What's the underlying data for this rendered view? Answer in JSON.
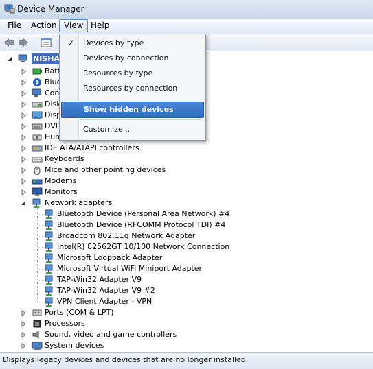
{
  "window": {
    "title": "Device Manager"
  },
  "menubar": {
    "file": "File",
    "action": "Action",
    "view": "View",
    "help": "Help"
  },
  "view_menu": {
    "items": [
      {
        "label": "Devices by type",
        "checked": true
      },
      {
        "label": "Devices by connection",
        "checked": false
      },
      {
        "label": "Resources by type",
        "checked": false
      },
      {
        "label": "Resources by connection",
        "checked": false
      },
      {
        "label": "Show hidden devices",
        "highlighted": true
      },
      {
        "label": "Customize..."
      }
    ],
    "check_glyph": "✓"
  },
  "tree": {
    "root": "NISHA",
    "categories": [
      {
        "label": "Batt",
        "icon": "battery-icon",
        "expanded": false
      },
      {
        "label": "Blue",
        "icon": "bluetooth-icon",
        "expanded": false
      },
      {
        "label": "Con",
        "icon": "computer-icon",
        "expanded": false
      },
      {
        "label": "Disk",
        "icon": "disk-drive-icon",
        "expanded": false
      },
      {
        "label": "Disp",
        "icon": "display-adapter-icon",
        "expanded": false
      },
      {
        "label": "DVD",
        "icon": "dvd-drive-icon",
        "expanded": false
      },
      {
        "label": "Human Interface Devices",
        "icon": "hid-icon",
        "expanded": false
      },
      {
        "label": "IDE ATA/ATAPI controllers",
        "icon": "ide-controller-icon",
        "expanded": false
      },
      {
        "label": "Keyboards",
        "icon": "keyboard-icon",
        "expanded": false
      },
      {
        "label": "Mice and other pointing devices",
        "icon": "mouse-icon",
        "expanded": false
      },
      {
        "label": "Modems",
        "icon": "modem-icon",
        "expanded": false
      },
      {
        "label": "Monitors",
        "icon": "monitor-icon",
        "expanded": false
      },
      {
        "label": "Network adapters",
        "icon": "network-adapter-icon",
        "expanded": true
      }
    ],
    "network_children": [
      "Bluetooth Device (Personal Area Network) #4",
      "Bluetooth Device (RFCOMM Protocol TDI) #4",
      "Broadcom 802.11g Network Adapter",
      "Intel(R) 82562GT 10/100 Network Connection",
      "Microsoft Loopback Adapter",
      "Microsoft Virtual WiFi Miniport Adapter",
      "TAP-Win32 Adapter V9",
      "TAP-Win32 Adapter V9 #2",
      "VPN Client Adapter - VPN"
    ],
    "after_categories": [
      {
        "label": "Ports (COM & LPT)",
        "icon": "port-icon"
      },
      {
        "label": "Processors",
        "icon": "processor-icon"
      },
      {
        "label": "Sound, video and game controllers",
        "icon": "sound-icon"
      },
      {
        "label": "System devices",
        "icon": "system-device-icon"
      }
    ]
  },
  "status": {
    "text": "Displays legacy devices and devices that are no longer installed."
  }
}
